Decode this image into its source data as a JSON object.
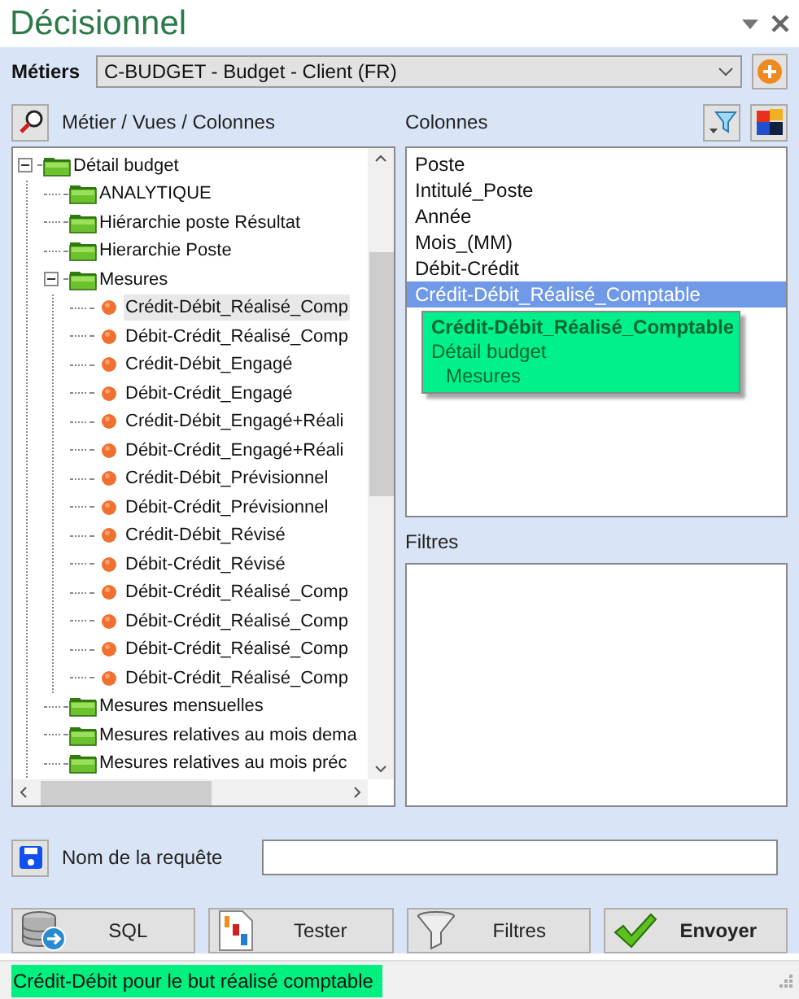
{
  "window": {
    "title": "Décisionnel"
  },
  "metiers": {
    "label": "Métiers",
    "value": "C-BUDGET - Budget - Client (FR)"
  },
  "tree_panel": {
    "label": "Métier / Vues / Colonnes"
  },
  "tree": [
    {
      "label": "Détail budget",
      "kind": "folder",
      "expanded": true,
      "selected": false,
      "children": [
        {
          "label": "ANALYTIQUE",
          "kind": "folder",
          "selected": false
        },
        {
          "label": "Hiérarchie poste Résultat",
          "kind": "folder",
          "selected": false
        },
        {
          "label": "Hierarchie Poste",
          "kind": "folder",
          "selected": false
        },
        {
          "label": "Mesures",
          "kind": "folder",
          "expanded": true,
          "selected": false,
          "children": [
            {
              "label": "Crédit-Débit_Réalisé_Comp",
              "kind": "measure",
              "selected": true
            },
            {
              "label": "Débit-Crédit_Réalisé_Comp",
              "kind": "measure",
              "selected": false
            },
            {
              "label": "Crédit-Débit_Engagé",
              "kind": "measure",
              "selected": false
            },
            {
              "label": "Débit-Crédit_Engagé",
              "kind": "measure",
              "selected": false
            },
            {
              "label": "Crédit-Débit_Engagé+Réali",
              "kind": "measure",
              "selected": false
            },
            {
              "label": "Débit-Crédit_Engagé+Réali",
              "kind": "measure",
              "selected": false
            },
            {
              "label": "Crédit-Débit_Prévisionnel",
              "kind": "measure",
              "selected": false
            },
            {
              "label": "Débit-Crédit_Prévisionnel",
              "kind": "measure",
              "selected": false
            },
            {
              "label": "Crédit-Débit_Révisé",
              "kind": "measure",
              "selected": false
            },
            {
              "label": "Débit-Crédit_Révisé",
              "kind": "measure",
              "selected": false
            },
            {
              "label": "Débit-Crédit_Réalisé_Comp",
              "kind": "measure",
              "selected": false
            },
            {
              "label": "Débit-Crédit_Réalisé_Comp",
              "kind": "measure",
              "selected": false
            },
            {
              "label": "Débit-Crédit_Réalisé_Comp",
              "kind": "measure",
              "selected": false
            },
            {
              "label": "Débit-Crédit_Réalisé_Comp",
              "kind": "measure",
              "selected": false
            }
          ]
        },
        {
          "label": "Mesures mensuelles",
          "kind": "folder",
          "selected": false
        },
        {
          "label": "Mesures relatives au mois dema",
          "kind": "folder",
          "selected": false
        },
        {
          "label": "Mesures relatives au mois préc",
          "kind": "folder",
          "selected": false
        }
      ]
    }
  ],
  "columns_panel": {
    "label": "Colonnes"
  },
  "columns": [
    {
      "label": "Poste",
      "selected": false
    },
    {
      "label": "Intitulé_Poste",
      "selected": false
    },
    {
      "label": "Année",
      "selected": false
    },
    {
      "label": "Mois_(MM)",
      "selected": false
    },
    {
      "label": "Débit-Crédit",
      "selected": false
    },
    {
      "label": "Crédit-Débit_Réalisé_Comptable",
      "selected": true
    }
  ],
  "tooltip": {
    "title": "Crédit-Débit_Réalisé_Comptable",
    "lines": [
      "Détail budget",
      "Mesures"
    ]
  },
  "filters_panel": {
    "label": "Filtres"
  },
  "request": {
    "label": "Nom de la requête"
  },
  "buttons": [
    {
      "label": "SQL",
      "kind": "sql"
    },
    {
      "label": "Tester",
      "kind": "test"
    },
    {
      "label": "Filtres",
      "kind": "filter"
    },
    {
      "label": "Envoyer",
      "kind": "send"
    }
  ],
  "status_bar": {
    "text": "Crédit-Débit pour le but réalisé comptable"
  }
}
